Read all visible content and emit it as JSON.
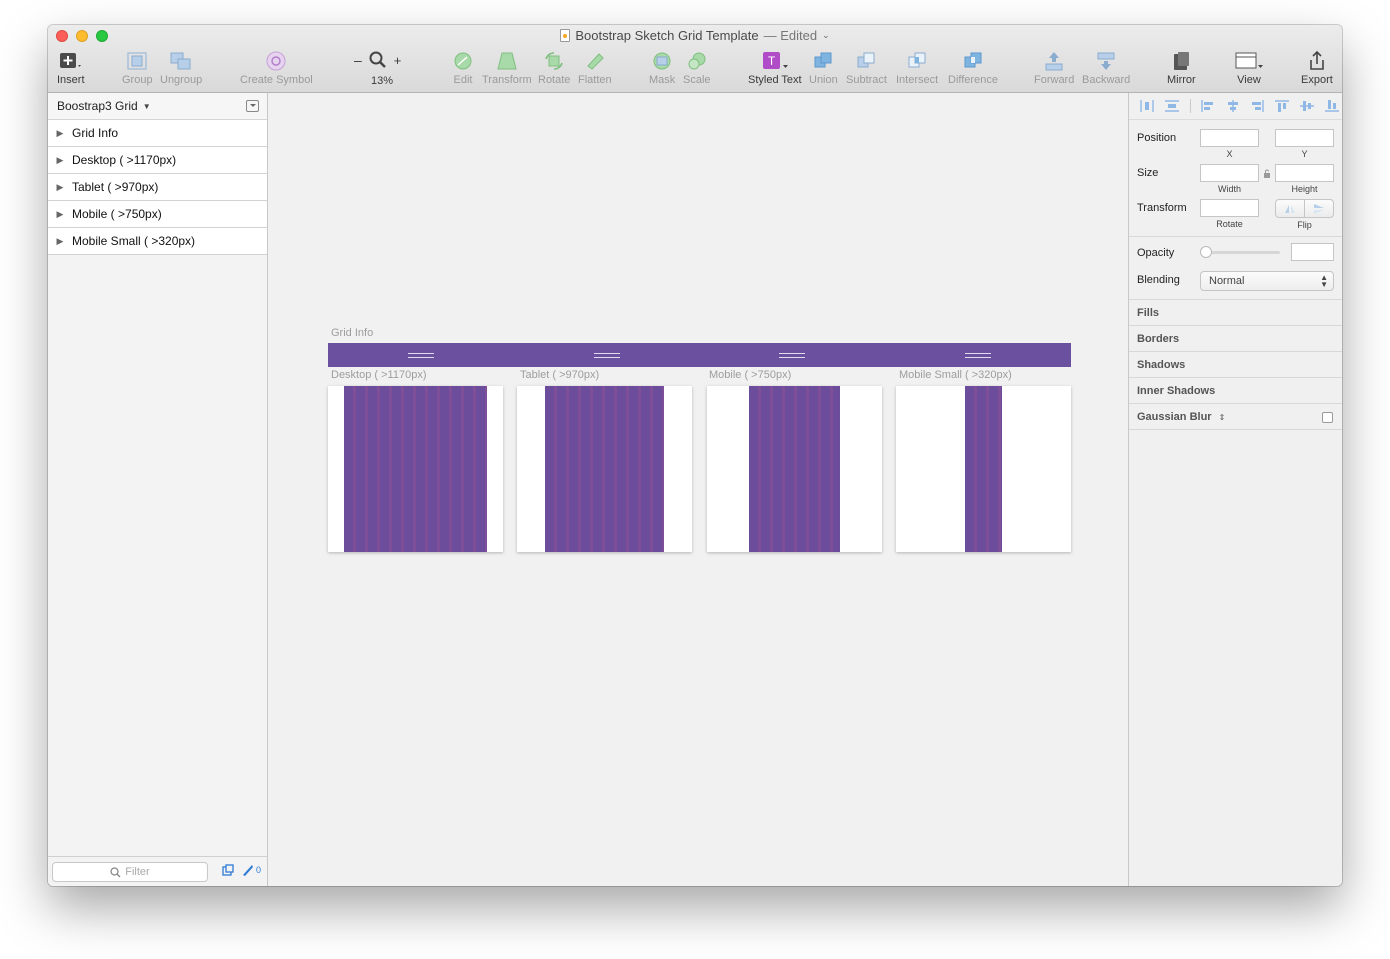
{
  "window": {
    "title": "Bootstrap Sketch Grid Template",
    "edited": "— Edited"
  },
  "toolbar": {
    "insert": "Insert",
    "group": "Group",
    "ungroup": "Ungroup",
    "create_symbol": "Create Symbol",
    "zoom_minus": "–",
    "zoom_plus": "+",
    "zoom_level": "13%",
    "edit": "Edit",
    "transform": "Transform",
    "rotate": "Rotate",
    "flatten": "Flatten",
    "mask": "Mask",
    "scale": "Scale",
    "styled_text": "Styled Text",
    "union": "Union",
    "subtract": "Subtract",
    "intersect": "Intersect",
    "difference": "Difference",
    "forward": "Forward",
    "backward": "Backward",
    "mirror": "Mirror",
    "view": "View",
    "export": "Export"
  },
  "sidebar": {
    "page": "Boostrap3 Grid",
    "layers": [
      {
        "label": "Grid Info"
      },
      {
        "label": "Desktop ( >1170px)"
      },
      {
        "label": "Tablet ( >970px)"
      },
      {
        "label": "Mobile ( >750px)"
      },
      {
        "label": "Mobile Small ( >320px)"
      }
    ],
    "filter_placeholder": "Filter",
    "slice_count": "0"
  },
  "canvas": {
    "grid_info_label": "Grid Info",
    "artboards": [
      {
        "label": "Desktop ( >1170px)"
      },
      {
        "label": "Tablet ( >970px)"
      },
      {
        "label": "Mobile ( >750px)"
      },
      {
        "label": "Mobile Small ( >320px)"
      }
    ]
  },
  "inspector": {
    "position": "Position",
    "x": "X",
    "y": "Y",
    "size": "Size",
    "width": "Width",
    "height": "Height",
    "transform": "Transform",
    "rotate": "Rotate",
    "flip": "Flip",
    "opacity": "Opacity",
    "blending": "Blending",
    "blending_value": "Normal",
    "fills": "Fills",
    "borders": "Borders",
    "shadows": "Shadows",
    "inner_shadows": "Inner Shadows",
    "gaussian_blur": "Gaussian Blur"
  },
  "colors": {
    "grid_purple": "#6c50a0",
    "accent_blue": "#2e7bd6",
    "styled_text_magenta": "#b04cc8"
  }
}
